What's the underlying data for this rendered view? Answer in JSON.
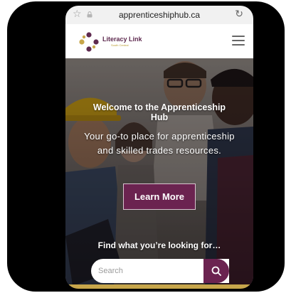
{
  "browser": {
    "domain": "apprenticeshiphub.ca",
    "icons": {
      "bookmark": "star-icon",
      "secure": "lock-icon",
      "reload": "reload-icon"
    }
  },
  "header": {
    "logo_name": "Literacy Link",
    "logo_subtitle": "South Central",
    "menu_icon": "hamburger-menu-icon"
  },
  "hero": {
    "title": "Welcome to the Apprenticeship Hub",
    "subtitle": "Your go-to place for apprenticeship and skilled trades resources.",
    "cta_label": "Learn More"
  },
  "search": {
    "label": "Find what you’re looking for…",
    "placeholder": "Search",
    "button_icon": "search-icon"
  },
  "colors": {
    "brand_plum": "#6b2350",
    "brand_gold": "#c7a64b",
    "url_bar": "#f1f1f1"
  }
}
